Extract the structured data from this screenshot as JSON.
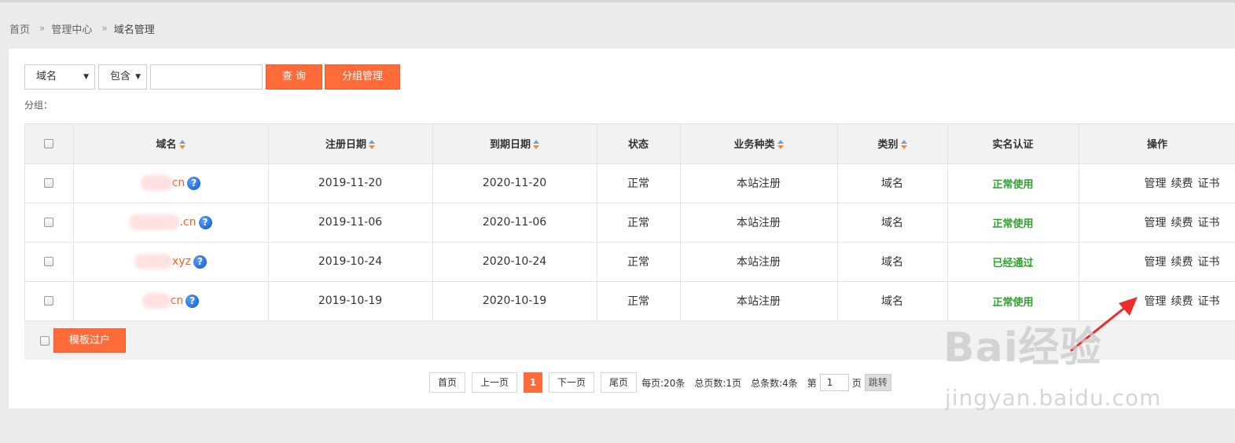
{
  "breadcrumb": {
    "home": "首页",
    "center": "管理中心",
    "current": "域名管理",
    "sep": "»"
  },
  "toolbar": {
    "field_select": "域名",
    "match_select": "包含",
    "search_placeholder": "",
    "query_button": "查 询",
    "group_button": "分组管理"
  },
  "group_label": "分组：",
  "table": {
    "headers": {
      "domain": "域名",
      "reg_date": "注册日期",
      "exp_date": "到期日期",
      "status": "状态",
      "business": "业务种类",
      "category": "类别",
      "realname": "实名认证",
      "ops": "操作"
    },
    "rows": [
      {
        "domain_suffix": "cn",
        "reg_date": "2019-11-20",
        "exp_date": "2020-11-20",
        "status": "正常",
        "business": "本站注册",
        "category": "域名",
        "realname": "正常使用"
      },
      {
        "domain_suffix": ".cn",
        "reg_date": "2019-11-06",
        "exp_date": "2020-11-06",
        "status": "正常",
        "business": "本站注册",
        "category": "域名",
        "realname": "正常使用"
      },
      {
        "domain_suffix": "xyz",
        "reg_date": "2019-10-24",
        "exp_date": "2020-10-24",
        "status": "正常",
        "business": "本站注册",
        "category": "域名",
        "realname": "已经通过"
      },
      {
        "domain_suffix": "cn",
        "reg_date": "2019-10-19",
        "exp_date": "2020-10-19",
        "status": "正常",
        "business": "本站注册",
        "category": "域名",
        "realname": "正常使用"
      }
    ],
    "op_labels": {
      "manage": "管理",
      "renew": "续费",
      "cert": "证书"
    },
    "help_glyph": "?"
  },
  "template_button": "模板过户",
  "pager": {
    "first": "首页",
    "prev": "上一页",
    "current": "1",
    "next": "下一页",
    "last": "尾页",
    "per_page": "每页:20条",
    "total_pages": "总页数:1页",
    "total_items": "总条数:4条",
    "goto_prefix": "第",
    "goto_value": "1",
    "goto_suffix": "页",
    "jump": "跳转"
  },
  "watermark": {
    "main": "Bai经验",
    "sub": "jingyan.baidu.com"
  },
  "colors": {
    "accent": "#ff6c3a",
    "green": "#2ea12e",
    "domain": "#ff5a1f",
    "annotation": "#ee2b2b"
  }
}
